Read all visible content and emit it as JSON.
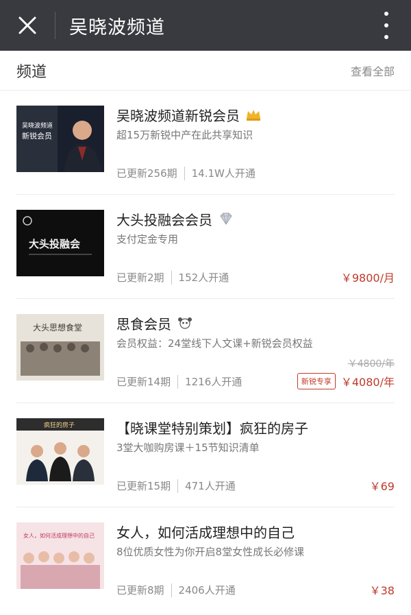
{
  "header": {
    "title": "吴晓波频道",
    "close_icon": "close-icon",
    "more_icon": "more-vertical-icon"
  },
  "section": {
    "title": "频道",
    "view_all": "查看全部"
  },
  "items": [
    {
      "name": "吴晓波频道新锐会员",
      "badge": "crown-icon",
      "desc": "超15万新锐中产在此共享知识",
      "updates": "已更新256期",
      "subs": "14.1W人开通",
      "price": "",
      "old_price": "",
      "tag": "",
      "thumb_text": [
        "吴晓波频道",
        "新锐会员"
      ]
    },
    {
      "name": "大头投融会会员",
      "badge": "diamond-icon",
      "desc": "支付定金专用",
      "updates": "已更新2期",
      "subs": "152人开通",
      "price": "￥9800/月",
      "old_price": "",
      "tag": "",
      "thumb_text": [
        "大头投融会"
      ]
    },
    {
      "name": "思食会员",
      "badge": "mascot-icon",
      "desc": "会员权益：24堂线下人文课+新锐会员权益",
      "updates": "已更新14期",
      "subs": "1216人开通",
      "price": "￥4080/年",
      "old_price": "￥4800/年",
      "tag": "新锐专享",
      "thumb_text": [
        "大头思想食堂"
      ]
    },
    {
      "name": "【晓课堂特别策划】疯狂的房子",
      "badge": "",
      "desc": "3堂大咖购房课＋15节知识清单",
      "updates": "已更新15期",
      "subs": "471人开通",
      "price": "￥69",
      "old_price": "",
      "tag": "",
      "thumb_text": [
        "疯狂的房子"
      ]
    },
    {
      "name": "女人，如何活成理想中的自己",
      "badge": "",
      "desc": "8位优质女性为你开启8堂女性成长必修课",
      "updates": "已更新8期",
      "subs": "2406人开通",
      "price": "￥38",
      "old_price": "",
      "tag": "",
      "thumb_text": [
        "女人，如何活成理想中的自己"
      ]
    }
  ],
  "colors": {
    "topbar": "#393a3f",
    "price": "#c0392b",
    "text": "#222222",
    "muted": "#888888"
  }
}
